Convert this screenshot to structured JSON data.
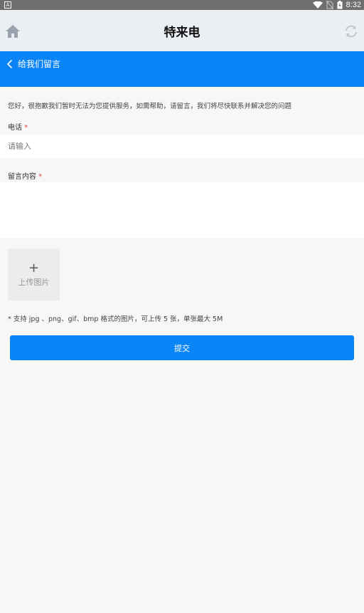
{
  "status_bar": {
    "left_icon": "A",
    "time": "8:32",
    "icons": [
      "wifi-icon",
      "no-sim-icon",
      "battery-icon"
    ]
  },
  "app_bar": {
    "title": "特来电",
    "left_icon": "home-icon",
    "right_icon": "refresh-icon"
  },
  "nav": {
    "back_icon": "chevron-left-icon",
    "title": "给我们留言"
  },
  "form": {
    "notice": "您好，很抱歉我们暂时无法为您提供服务，如需帮助，请留言，我们将尽快联系并解决您的问题",
    "phone_label": "电话",
    "phone_required": "*",
    "phone_placeholder": "请输入",
    "message_label": "留言内容",
    "message_required": "*",
    "upload_plus": "+",
    "upload_label": "上传图片",
    "hint": "* 支持 jpg 、png、gif、bmp 格式的图片，可上传 5 张，单张最大 5M",
    "submit_label": "提交"
  },
  "colors": {
    "primary": "#0b84f7",
    "app_bar_bg": "#ebeef2",
    "status_bar_bg": "#6e6e6e",
    "required": "#e0463c"
  }
}
